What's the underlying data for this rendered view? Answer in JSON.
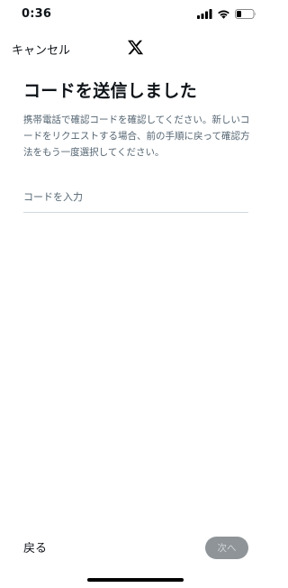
{
  "status_bar": {
    "time": "0:36"
  },
  "nav": {
    "cancel_label": "キャンセル",
    "logo_icon": "x-logo-icon"
  },
  "main": {
    "title": "コードを送信しました",
    "description": "携帯電話で確認コードを確認してください。新しいコードをリクエストする場合、前の手順に戻って確認方法をもう一度選択してください。",
    "code_input": {
      "value": "",
      "placeholder": "コードを入力"
    }
  },
  "footer": {
    "back_label": "戻る",
    "next_label": "次へ",
    "next_enabled": false
  },
  "colors": {
    "text_primary": "#0f1419",
    "text_secondary": "#536471",
    "input_border": "#cfd9de",
    "next_button_bg": "#8f9498",
    "next_button_text": "#d2d5d8"
  }
}
